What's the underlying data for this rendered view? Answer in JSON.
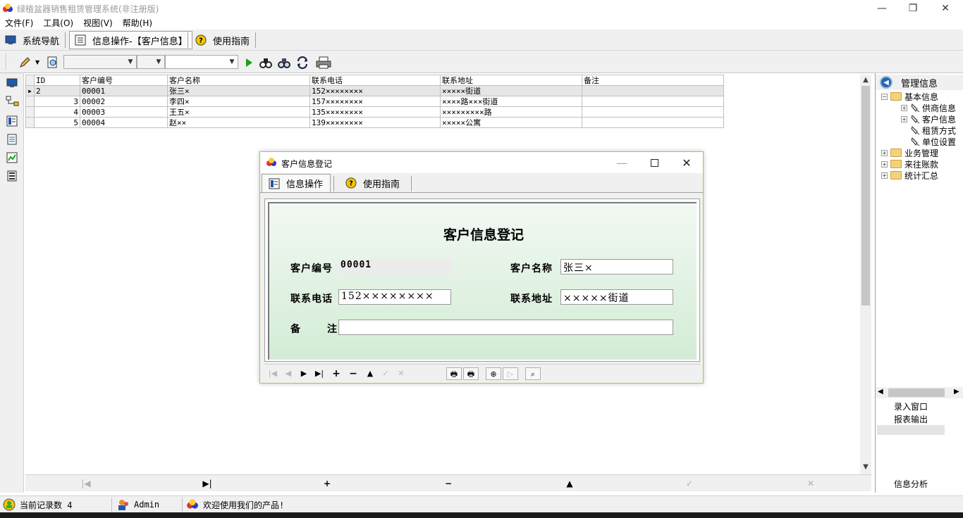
{
  "window": {
    "title": "绿植盆器销售租赁管理系统(非注册版)",
    "minimize": "—",
    "restore": "❐",
    "close": "✕"
  },
  "menu": [
    "文件(F)",
    "工具(O)",
    "视图(V)",
    "帮助(H)"
  ],
  "navtabs": {
    "nav": "系统导航",
    "info": "信息操作-【客户信息】",
    "guide": "使用指南"
  },
  "grid": {
    "columns": [
      "ID",
      "客户编号",
      "客户名称",
      "联系电话",
      "联系地址",
      "备注"
    ],
    "rows": [
      {
        "id": "2",
        "code": "00001",
        "name": "张三×",
        "phone": "152××××××××",
        "address": "×××××街道",
        "note": ""
      },
      {
        "id": "3",
        "code": "00002",
        "name": "李四×",
        "phone": "157××××××××",
        "address": "××××路×××街道",
        "note": ""
      },
      {
        "id": "4",
        "code": "00003",
        "name": "王五×",
        "phone": "135××××××××",
        "address": "×××××××××路",
        "note": ""
      },
      {
        "id": "5",
        "code": "00004",
        "name": "赵××",
        "phone": "139××××××××",
        "address": "×××××公寓",
        "note": ""
      }
    ]
  },
  "right_panel": {
    "title": "管理信息",
    "tree": {
      "basic": "基本信息",
      "supplier": "供商信息",
      "customer": "客户信息",
      "rental": "租赁方式",
      "unit": "单位设置",
      "business": "业务管理",
      "accounts": "来往账款",
      "summary": "统计汇总"
    },
    "entry_window": "录入窗口",
    "report_output": "报表输出",
    "info_analysis": "信息分析"
  },
  "status": {
    "record_count": "当前记录数 4",
    "user": "Admin",
    "welcome": "欢迎使用我们的产品!"
  },
  "dialog": {
    "title": "客户信息登记",
    "tab_info": "信息操作",
    "tab_guide": "使用指南",
    "form_title": "客户信息登记",
    "labels": {
      "code": "客户编号",
      "name": "客户名称",
      "phone": "联系电话",
      "address": "联系地址",
      "note_a": "备",
      "note_b": "注"
    },
    "values": {
      "code": "00001",
      "name": "张三×",
      "phone": "152××××××××",
      "address": "×××××街道",
      "note": ""
    }
  },
  "colors": {
    "dialog_border": "#9ccc65",
    "form_gradient_top": "#f2f8f2",
    "form_gradient_bottom": "#d3ecd6",
    "toolbar_bg": "#f0f0f0"
  }
}
